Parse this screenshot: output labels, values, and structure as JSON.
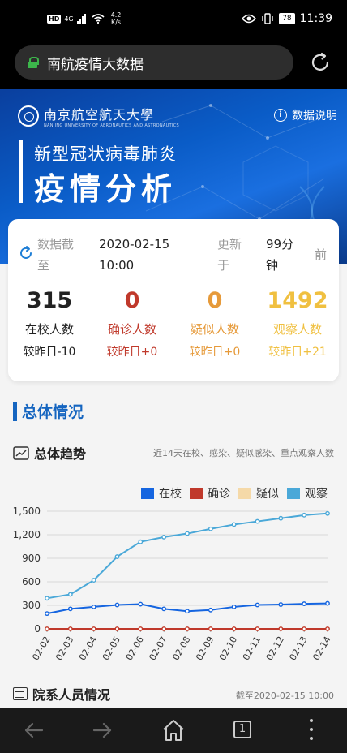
{
  "status_bar": {
    "hd": "HD",
    "network": "4G",
    "speed_value": "4.2",
    "speed_unit": "K/s",
    "battery": "78",
    "time": "11:39"
  },
  "browser": {
    "address_text": "南航疫情大数据"
  },
  "banner": {
    "university_name": "南京航空航天大學",
    "university_en": "NANJING UNIVERSITY OF AERONAUTICS AND ASTRONAUTICS",
    "subtitle": "新型冠状病毒肺炎",
    "title": "疫情分析",
    "info_link": "数据说明"
  },
  "summary": {
    "cutoff_label": "数据截至",
    "cutoff_date": "2020-02-15 10:00",
    "updated_label": "更新于",
    "updated_ago": "99分钟",
    "ago_suffix": "前",
    "stats": [
      {
        "value": "315",
        "label": "在校人数",
        "delta": "较昨日-10",
        "color": "#222222"
      },
      {
        "value": "0",
        "label": "确诊人数",
        "delta": "较昨日+0",
        "color": "#c0392b"
      },
      {
        "value": "0",
        "label": "疑似人数",
        "delta": "较昨日+0",
        "color": "#e69a3a"
      },
      {
        "value": "1492",
        "label": "观察人数",
        "delta": "较昨日+21",
        "color": "#f0c040"
      }
    ]
  },
  "section": {
    "title": "总体情况"
  },
  "trend": {
    "title": "总体趋势",
    "note": "近14天在校、感染、疑似感染、重点观察人数"
  },
  "chart_data": {
    "type": "line",
    "categories": [
      "02-02",
      "02-03",
      "02-04",
      "02-05",
      "02-06",
      "02-07",
      "02-08",
      "02-09",
      "02-10",
      "02-11",
      "02-12",
      "02-13",
      "02-14"
    ],
    "series": [
      {
        "name": "在校",
        "color": "#1565e0",
        "values": [
          195,
          255,
          280,
          305,
          315,
          255,
          225,
          240,
          280,
          305,
          310,
          320,
          325
        ]
      },
      {
        "name": "确诊",
        "color": "#c0392b",
        "values": [
          0,
          0,
          0,
          0,
          0,
          0,
          0,
          0,
          0,
          0,
          0,
          0,
          0
        ]
      },
      {
        "name": "疑似",
        "color": "#f5d9a8",
        "values": [
          0,
          0,
          0,
          0,
          0,
          0,
          0,
          0,
          0,
          0,
          0,
          0,
          0
        ]
      },
      {
        "name": "观察",
        "color": "#4aa8d8",
        "values": [
          390,
          440,
          620,
          920,
          1110,
          1170,
          1215,
          1275,
          1330,
          1370,
          1410,
          1450,
          1471
        ]
      }
    ],
    "yticks": [
      "0",
      "300",
      "600",
      "900",
      "1,200",
      "1,500"
    ],
    "ylim": [
      0,
      1500
    ],
    "grid": true,
    "legend": "top-right"
  },
  "departments": {
    "title": "院系人员情况",
    "note": "截至2020-02-15 10:00"
  },
  "bottom_nav": {
    "tab_count": "1"
  }
}
